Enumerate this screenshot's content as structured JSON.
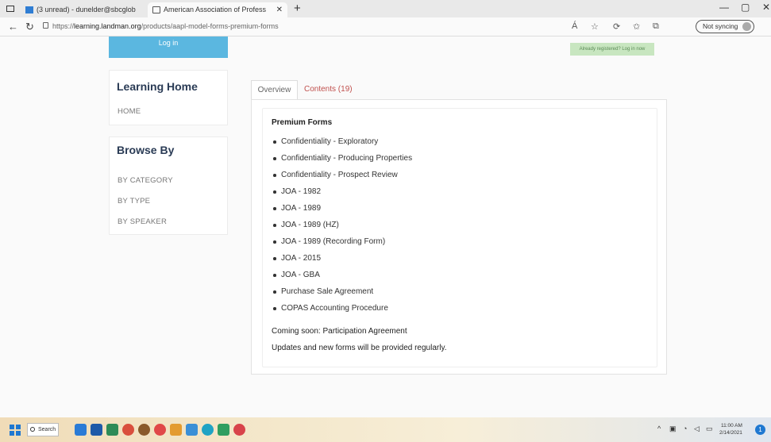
{
  "browser": {
    "tabs": [
      {
        "label": "(3 unread) - dunelder@sbcglob"
      },
      {
        "label": "American Association of Profess"
      }
    ],
    "url_prefix": "https://",
    "url_domain": "learning.landman.org",
    "url_path": "/products/aapl-model-forms-premium-forms",
    "read_aloud_label": "Á",
    "sync_label": "Not syncing"
  },
  "header": {
    "login_label": "Log in",
    "already_registered": "Already registered? Log in now"
  },
  "sidebar": {
    "learning_title": "Learning Home",
    "learning_items": [
      {
        "label": "HOME"
      }
    ],
    "browse_title": "Browse By",
    "browse_items": [
      {
        "label": "BY CATEGORY"
      },
      {
        "label": "BY TYPE"
      },
      {
        "label": "BY SPEAKER"
      }
    ]
  },
  "main": {
    "tabs": [
      {
        "label": "Overview",
        "active": true
      },
      {
        "label": "Contents (19)",
        "active": false
      }
    ],
    "section_title": "Premium Forms",
    "forms": [
      "Confidentiality - Exploratory",
      "Confidentiality - Producing Properties",
      "Confidentiality - Prospect Review",
      "JOA - 1982",
      "JOA - 1989",
      "JOA - 1989 (HZ)",
      "JOA - 1989 (Recording Form)",
      "JOA - 2015",
      "JOA - GBA",
      "Purchase Sale Agreement",
      "COPAS Accounting Procedure"
    ],
    "note1": "Coming soon: Participation Agreement",
    "note2": "Updates and new forms will be provided regularly."
  },
  "taskbar": {
    "search_label": "Search",
    "time": "11:00 AM",
    "date": "2/14/2021",
    "notification_count": "1"
  },
  "colors": {
    "login_button": "#5bb7e0",
    "already_badge": "#c8e6c0",
    "contents_tab": "#c0504d",
    "panel_title": "#2a3b55"
  }
}
